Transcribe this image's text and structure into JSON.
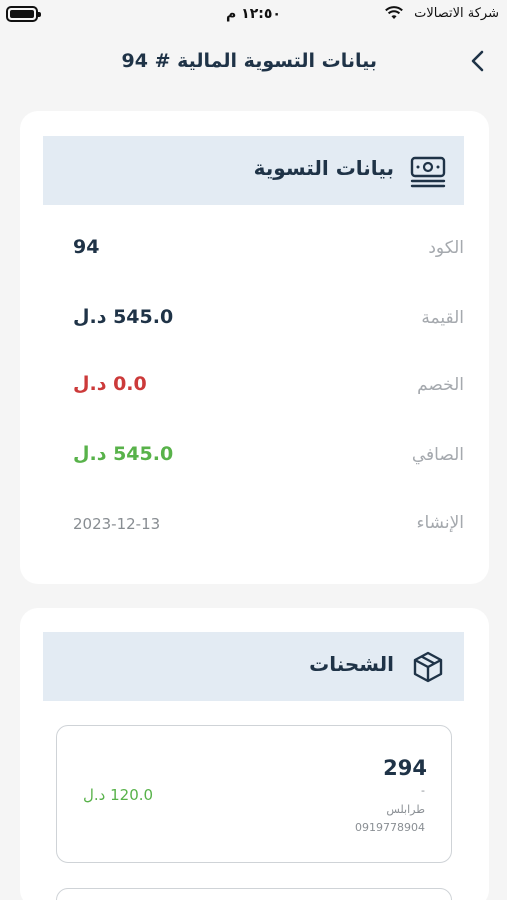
{
  "status_bar": {
    "carrier": "شركة الاتصالات",
    "time": "١٢:٥٠ م"
  },
  "header": {
    "title": "بيانات التسوية المالية # 94",
    "back_icon": "chevron-left-icon"
  },
  "settlement": {
    "title": "بيانات التسوية",
    "icon": "money-stack-icon",
    "rows": [
      {
        "label": "الكود",
        "value": "94"
      },
      {
        "label": "القيمة",
        "value": "545.0 د.ل"
      },
      {
        "label": "الخصم",
        "value": "0.0 د.ل"
      },
      {
        "label": "الصافي",
        "value": "545.0 د.ل"
      },
      {
        "label": "الإنشاء",
        "value": "2023-12-13"
      }
    ]
  },
  "shipments": {
    "title": "الشحنات",
    "icon": "package-box-icon",
    "items": [
      {
        "id": "294",
        "note": "-",
        "city": "طرابلس",
        "phone": "0919778904",
        "amount": "120.0 د.ل"
      }
    ]
  },
  "colors": {
    "primary": "#1f3347",
    "section_bg": "#e3ebf3",
    "green": "#58b24a",
    "red": "#cc3a3a"
  }
}
